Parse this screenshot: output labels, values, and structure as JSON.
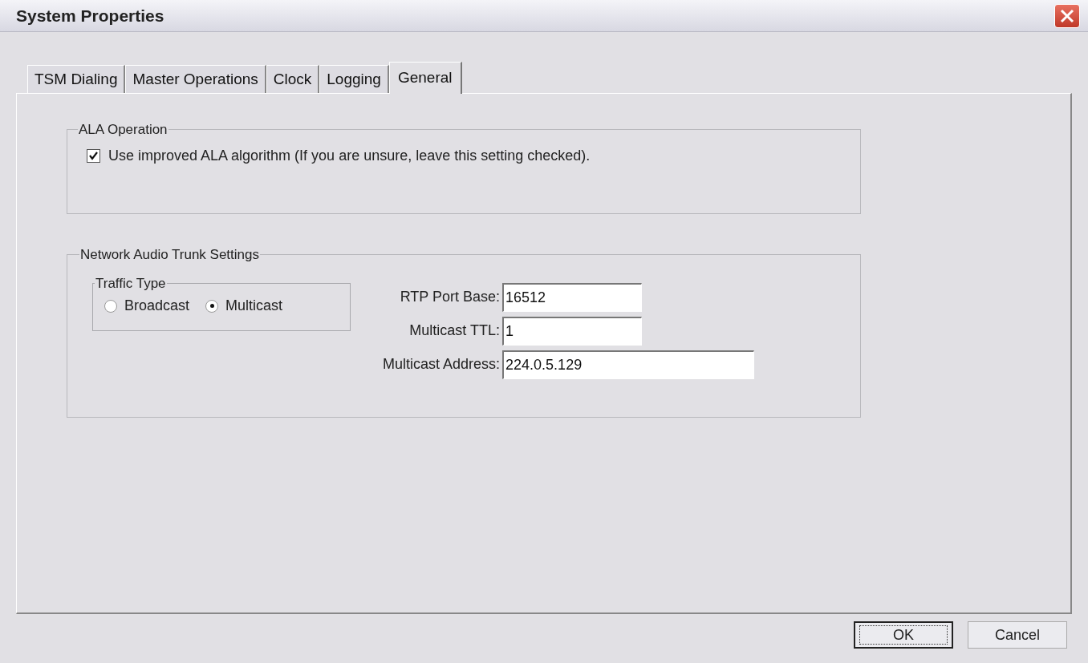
{
  "window": {
    "title": "System Properties"
  },
  "tabs": [
    {
      "label": "TSM Dialing",
      "selected": false
    },
    {
      "label": "Master Operations",
      "selected": false
    },
    {
      "label": "Clock",
      "selected": false
    },
    {
      "label": "Logging",
      "selected": false
    },
    {
      "label": "General",
      "selected": true
    }
  ],
  "ala_operation": {
    "title": "ALA Operation",
    "checkbox": {
      "label": "Use improved ALA algorithm (If you are unsure, leave this setting checked).",
      "checked": true
    }
  },
  "network_audio_trunk_settings": {
    "title": "Network Audio Trunk Settings",
    "traffic_type": {
      "title": "Traffic Type",
      "options": [
        {
          "label": "Broadcast",
          "selected": false
        },
        {
          "label": "Multicast",
          "selected": true
        }
      ]
    },
    "fields": [
      {
        "label": "RTP Port Base:",
        "value": "16512",
        "kind": "short"
      },
      {
        "label": "Multicast TTL:",
        "value": "1",
        "kind": "short"
      },
      {
        "label": "Multicast Address:",
        "value": "224.0.5.129",
        "kind": "long"
      }
    ]
  },
  "buttons": [
    {
      "label": "OK",
      "focused": true
    },
    {
      "label": "Cancel",
      "focused": false
    }
  ]
}
